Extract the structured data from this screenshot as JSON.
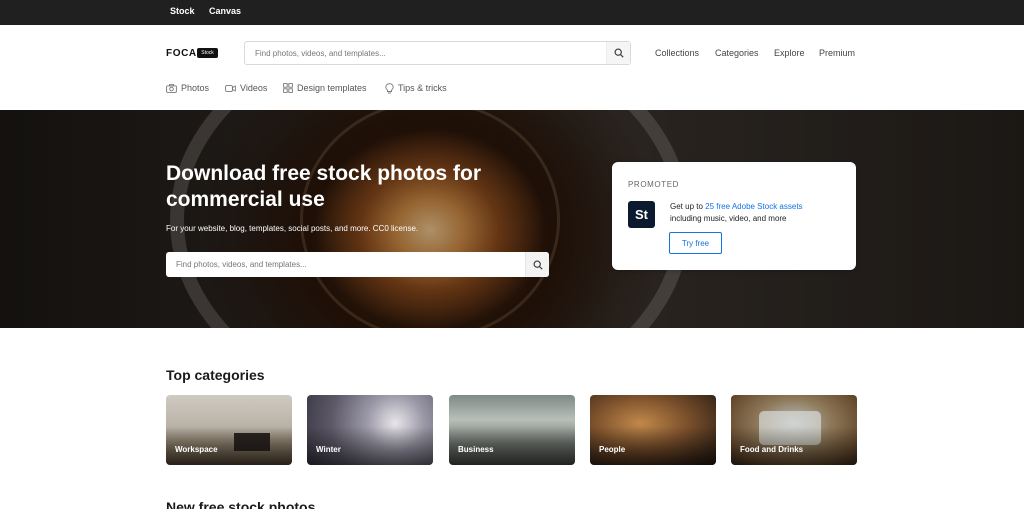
{
  "topbar": {
    "stock": "Stock",
    "canvas": "Canvas"
  },
  "header": {
    "logo": "FOCA",
    "logo_badge": "Stock",
    "search_placeholder": "Find photos, videos, and templates...",
    "nav": [
      "Collections",
      "Categories",
      "Explore",
      "Premium"
    ]
  },
  "subnav": [
    {
      "label": "Photos",
      "icon": "camera-icon"
    },
    {
      "label": "Videos",
      "icon": "video-camera-icon"
    },
    {
      "label": "Design templates",
      "icon": "grid-icon"
    },
    {
      "label": "Tips & tricks",
      "icon": "lightbulb-icon"
    }
  ],
  "hero": {
    "title": "Download free stock photos for commercial use",
    "subtitle": "For your website, blog, templates, social posts, and more. CC0 license.",
    "search_placeholder": "Find photos, videos, and templates..."
  },
  "promo": {
    "tag": "PROMOTED",
    "logo": "St",
    "line1_prefix": "Get up to ",
    "line1_link": "25 free Adobe Stock assets",
    "line2": "including music, video, and more",
    "button": "Try free",
    "accent": "#1473e6"
  },
  "categories": {
    "title": "Top categories",
    "items": [
      "Workspace",
      "Winter",
      "Business",
      "People",
      "Food and Drinks"
    ]
  },
  "new_section": {
    "title": "New free stock photos"
  },
  "colors": {
    "topbar_bg": "#202020",
    "accent": "#1473e6"
  }
}
